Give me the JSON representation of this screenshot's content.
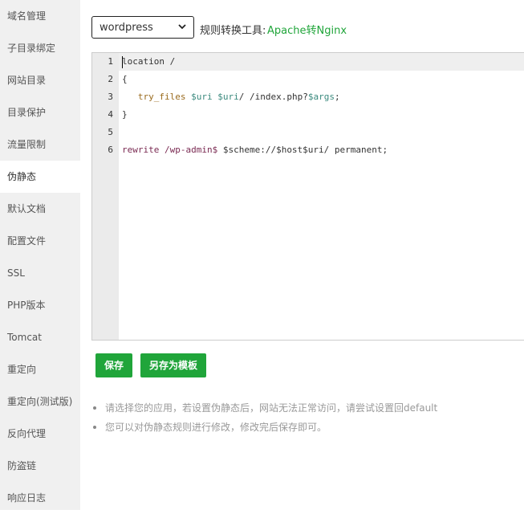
{
  "sidebar": {
    "items": [
      {
        "label": "域名管理"
      },
      {
        "label": "子目录绑定"
      },
      {
        "label": "网站目录"
      },
      {
        "label": "目录保护"
      },
      {
        "label": "流量限制"
      },
      {
        "label": "伪静态",
        "active": true
      },
      {
        "label": "默认文档"
      },
      {
        "label": "配置文件"
      },
      {
        "label": "SSL"
      },
      {
        "label": "PHP版本"
      },
      {
        "label": "Tomcat"
      },
      {
        "label": "重定向"
      },
      {
        "label": "重定向(测试版)"
      },
      {
        "label": "反向代理"
      },
      {
        "label": "防盗链"
      },
      {
        "label": "响应日志"
      }
    ]
  },
  "toolbar": {
    "select_value": "wordpress",
    "tool_label": "规则转换工具:",
    "tool_link": "Apache转Nginx"
  },
  "editor": {
    "line_numbers": [
      "1",
      "2",
      "3",
      "4",
      "5",
      "6"
    ],
    "lines": {
      "l1": "location /",
      "l2": "{",
      "l3_kw": "try_files",
      "l3_v1": "$uri",
      "l3_v2": "$uri",
      "l3_t1": "/ /index.php?",
      "l3_v3": "$args",
      "l3_t2": ";",
      "l4": "}",
      "l6_kw": "rewrite",
      "l6_re": "/wp-admin$",
      "l6_rest": "$scheme://$host$uri/ permanent;"
    }
  },
  "buttons": {
    "save": "保存",
    "save_template": "另存为模板"
  },
  "tips": [
    "请选择您的应用，若设置伪静态后，网站无法正常访问，请尝试设置回default",
    "您可以对伪静态规则进行修改，修改完后保存即可。"
  ],
  "colors": {
    "accent": "#20a53a",
    "sidebar_bg": "#f0f0f0"
  }
}
